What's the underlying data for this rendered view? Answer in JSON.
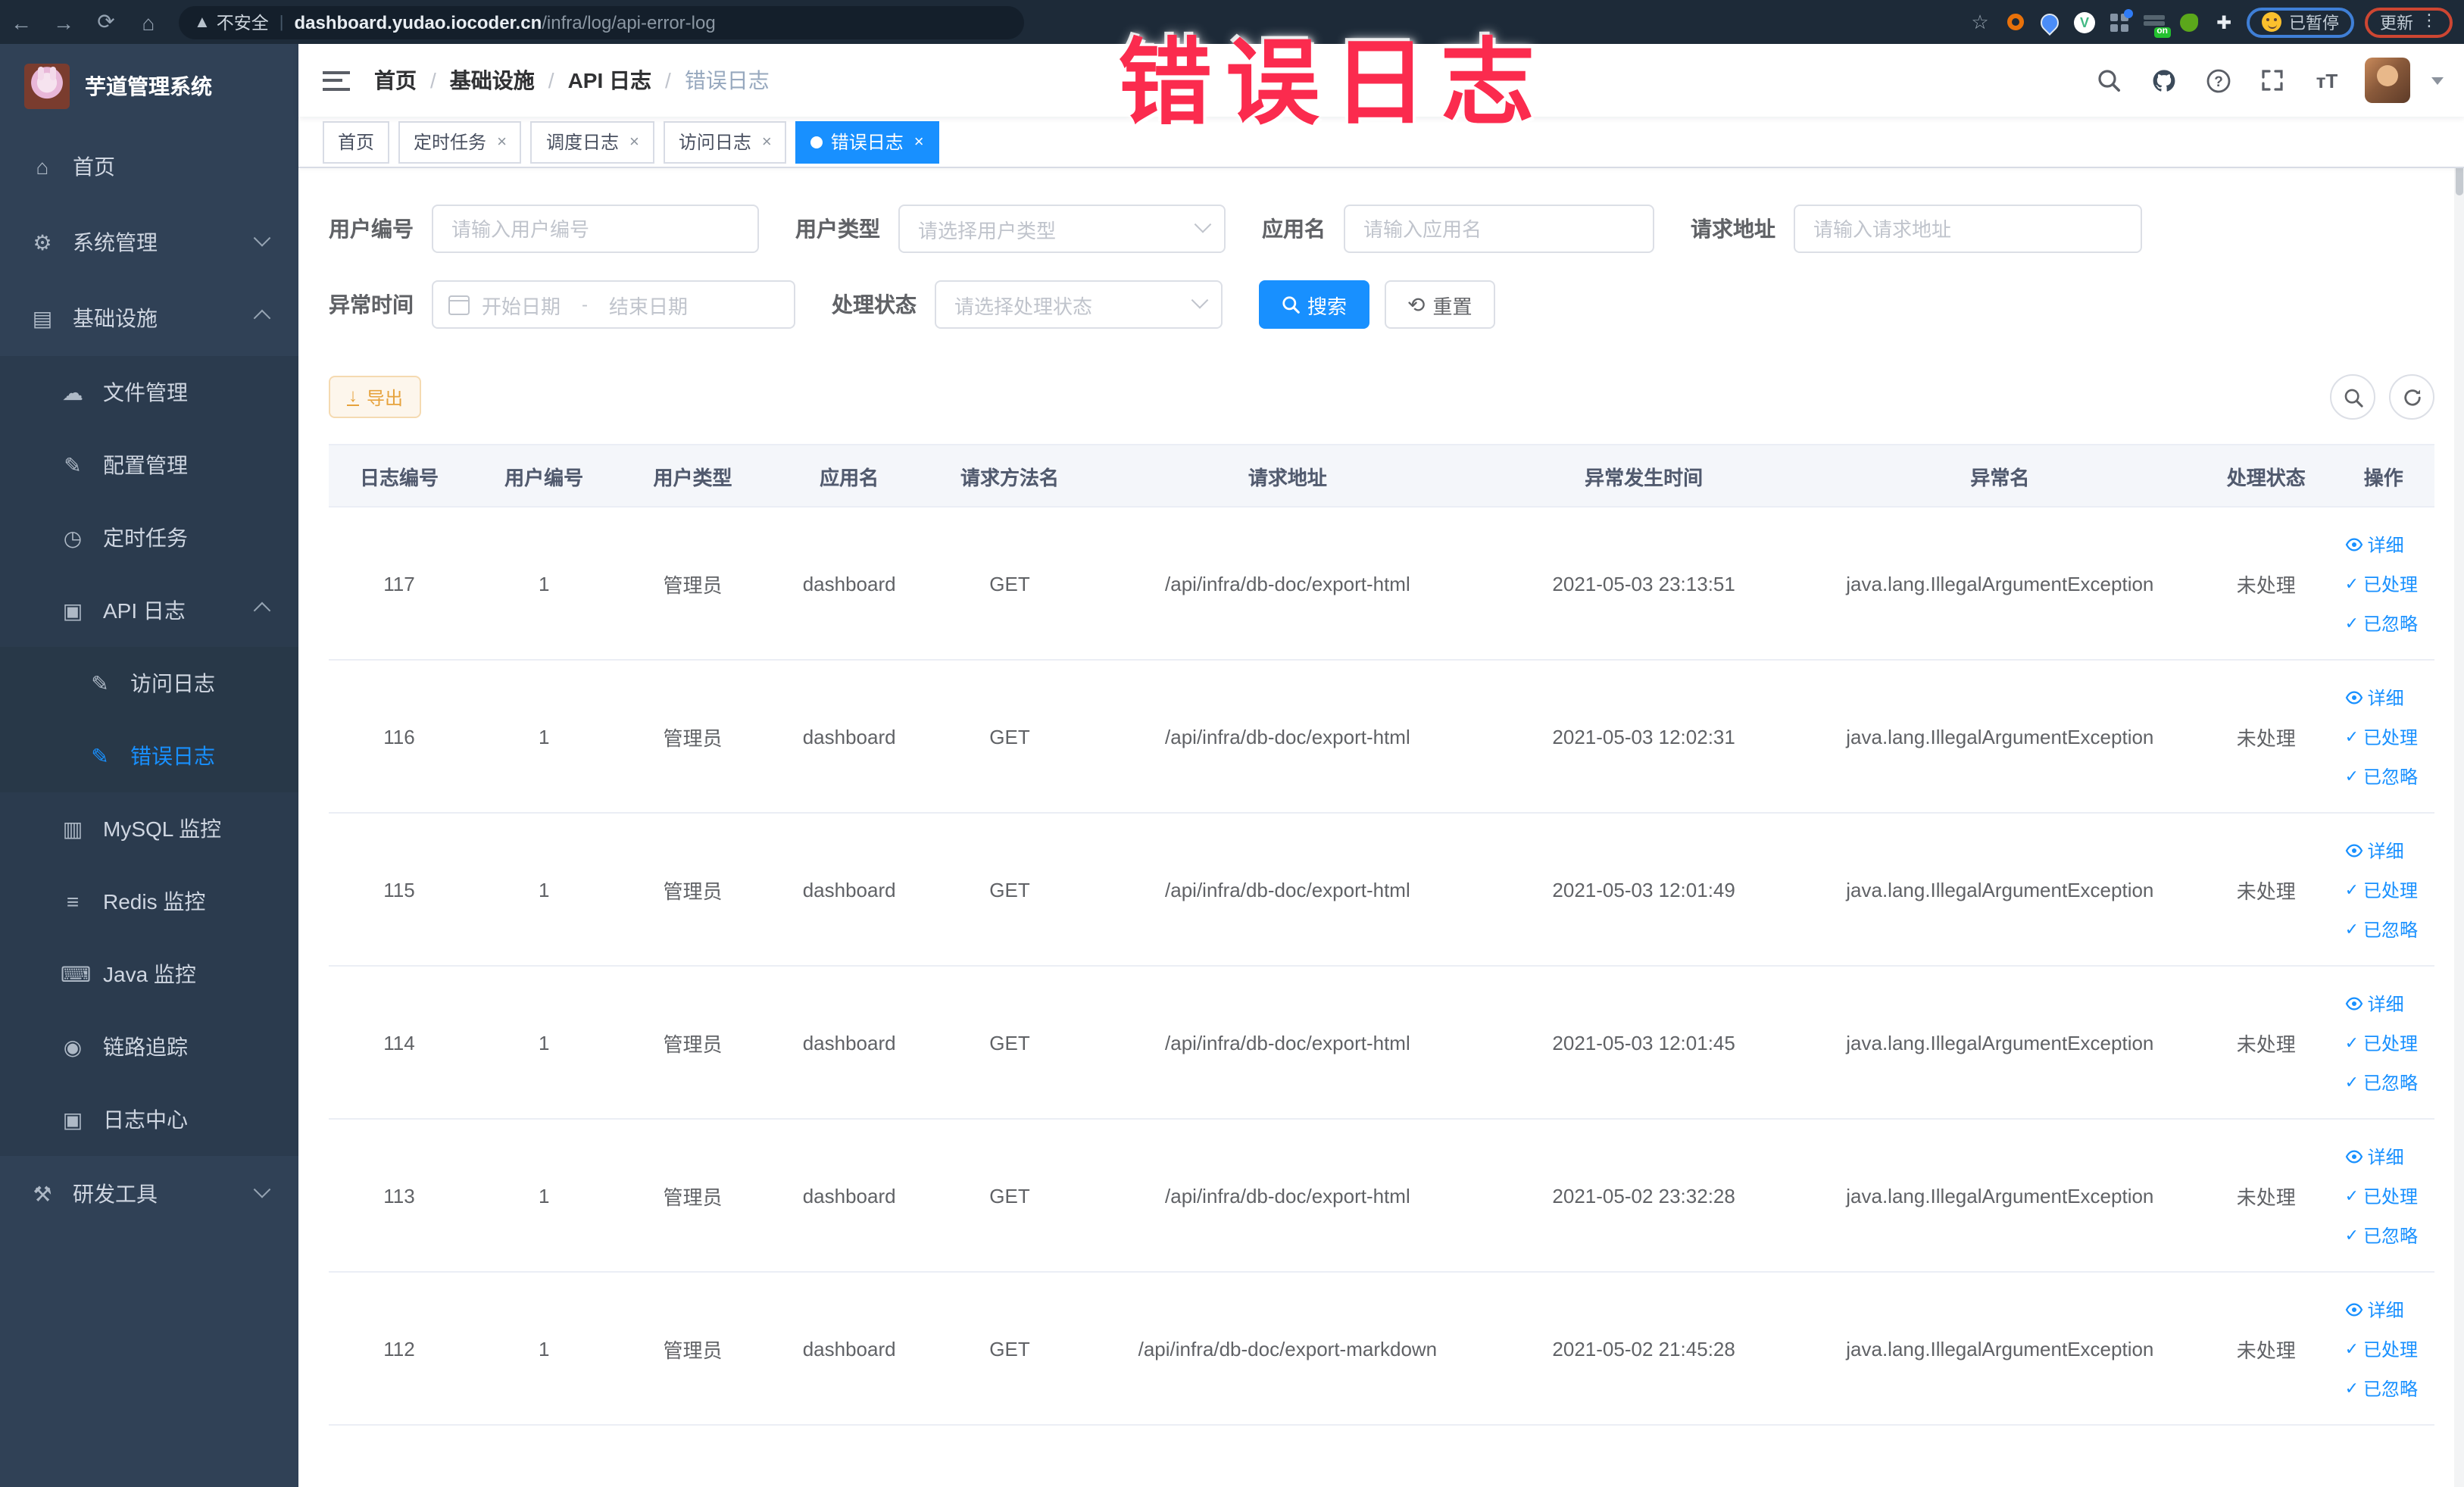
{
  "annotation": {
    "text": "错误日志",
    "color": "#fb2b4e"
  },
  "browser": {
    "security_label": "不安全",
    "url_host": "dashboard.yudao.iocoder.cn",
    "url_path": "/infra/log/api-error-log",
    "proxy_badge": "on",
    "paused_label": "已暂停",
    "update_label": "更新"
  },
  "sidebar": {
    "app_title": "芋道管理系统",
    "items": [
      {
        "label": "首页",
        "icon": "home-icon",
        "level": 1
      },
      {
        "label": "系统管理",
        "icon": "gear-icon",
        "level": 1,
        "chevron": "down"
      },
      {
        "label": "基础设施",
        "icon": "infrastructure-icon",
        "level": 1,
        "chevron": "up"
      },
      {
        "label": "文件管理",
        "icon": "file-upload-icon",
        "level": 2
      },
      {
        "label": "配置管理",
        "icon": "config-edit-icon",
        "level": 2
      },
      {
        "label": "定时任务",
        "icon": "schedule-icon",
        "level": 2
      },
      {
        "label": "API 日志",
        "icon": "api-log-icon",
        "level": 2,
        "chevron": "up"
      },
      {
        "label": "访问日志",
        "icon": "access-log-icon",
        "level": 3
      },
      {
        "label": "错误日志",
        "icon": "error-log-icon",
        "level": 3,
        "active": true
      },
      {
        "label": "MySQL 监控",
        "icon": "mysql-icon",
        "level": 2
      },
      {
        "label": "Redis 监控",
        "icon": "redis-icon",
        "level": 2
      },
      {
        "label": "Java 监控",
        "icon": "java-icon",
        "level": 2
      },
      {
        "label": "链路追踪",
        "icon": "trace-icon",
        "level": 2
      },
      {
        "label": "日志中心",
        "icon": "log-center-icon",
        "level": 2
      },
      {
        "label": "研发工具",
        "icon": "devtools-icon",
        "level": 1,
        "chevron": "down"
      }
    ]
  },
  "header": {
    "breadcrumb": [
      {
        "label": "首页"
      },
      {
        "label": "基础设施"
      },
      {
        "label": "API 日志"
      },
      {
        "label": "错误日志"
      }
    ]
  },
  "tabs": [
    {
      "label": "首页"
    },
    {
      "label": "定时任务",
      "closable": true
    },
    {
      "label": "调度日志",
      "closable": true
    },
    {
      "label": "访问日志",
      "closable": true
    },
    {
      "label": "错误日志",
      "closable": true,
      "active": true
    }
  ],
  "filters": {
    "user_id": {
      "label": "用户编号",
      "placeholder": "请输入用户编号"
    },
    "user_type": {
      "label": "用户类型",
      "placeholder": "请选择用户类型"
    },
    "app_name": {
      "label": "应用名",
      "placeholder": "请输入应用名"
    },
    "request_url": {
      "label": "请求地址",
      "placeholder": "请输入请求地址"
    },
    "exception_time": {
      "label": "异常时间",
      "start_placeholder": "开始日期",
      "separator": "-",
      "end_placeholder": "结束日期"
    },
    "process_status": {
      "label": "处理状态",
      "placeholder": "请选择处理状态"
    },
    "search_label": "搜索",
    "reset_label": "重置"
  },
  "toolbar": {
    "export_label": "导出"
  },
  "table": {
    "columns": [
      "日志编号",
      "用户编号",
      "用户类型",
      "应用名",
      "请求方法名",
      "请求地址",
      "异常发生时间",
      "异常名",
      "处理状态",
      "操作"
    ],
    "actions": {
      "detail": "详细",
      "processed": "已处理",
      "ignored": "已忽略"
    },
    "rows": [
      {
        "id": "117",
        "user_id": "1",
        "user_type": "管理员",
        "app": "dashboard",
        "method": "GET",
        "url": "/api/infra/db-doc/export-html",
        "time": "2021-05-03 23:13:51",
        "exception": "java.lang.IllegalArgumentException",
        "status": "未处理"
      },
      {
        "id": "116",
        "user_id": "1",
        "user_type": "管理员",
        "app": "dashboard",
        "method": "GET",
        "url": "/api/infra/db-doc/export-html",
        "time": "2021-05-03 12:02:31",
        "exception": "java.lang.IllegalArgumentException",
        "status": "未处理"
      },
      {
        "id": "115",
        "user_id": "1",
        "user_type": "管理员",
        "app": "dashboard",
        "method": "GET",
        "url": "/api/infra/db-doc/export-html",
        "time": "2021-05-03 12:01:49",
        "exception": "java.lang.IllegalArgumentException",
        "status": "未处理"
      },
      {
        "id": "114",
        "user_id": "1",
        "user_type": "管理员",
        "app": "dashboard",
        "method": "GET",
        "url": "/api/infra/db-doc/export-html",
        "time": "2021-05-03 12:01:45",
        "exception": "java.lang.IllegalArgumentException",
        "status": "未处理"
      },
      {
        "id": "113",
        "user_id": "1",
        "user_type": "管理员",
        "app": "dashboard",
        "method": "GET",
        "url": "/api/infra/db-doc/export-html",
        "time": "2021-05-02 23:32:28",
        "exception": "java.lang.IllegalArgumentException",
        "status": "未处理"
      },
      {
        "id": "112",
        "user_id": "1",
        "user_type": "管理员",
        "app": "dashboard",
        "method": "GET",
        "url": "/api/infra/db-doc/export-markdown",
        "time": "2021-05-02 21:45:28",
        "exception": "java.lang.IllegalArgumentException",
        "status": "未处理"
      }
    ]
  }
}
